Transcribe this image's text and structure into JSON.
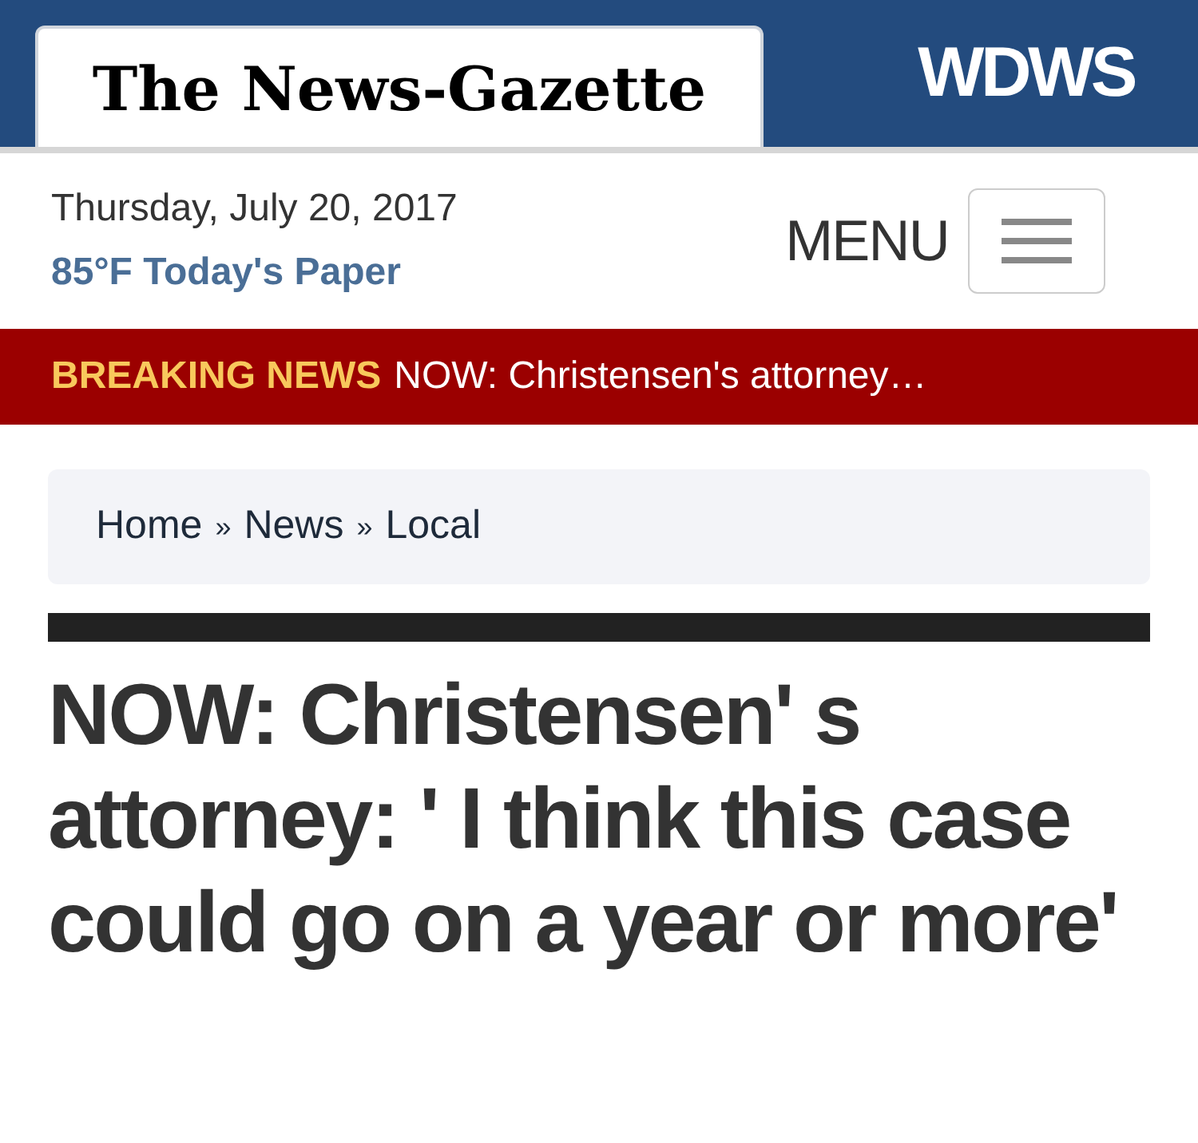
{
  "header": {
    "logo": "The News-Gazette",
    "station_link": "WDWS"
  },
  "date": "Thursday, July 20, 2017",
  "weather_link": "85°F Today's Paper",
  "menu": {
    "label": "MENU"
  },
  "breaking": {
    "label": "BREAKING NEWS",
    "headline": "NOW: Christensen's attorney…"
  },
  "breadcrumb": [
    {
      "label": "Home",
      "separator": "»"
    },
    {
      "label": "News",
      "separator": "»"
    },
    {
      "label": "Local"
    }
  ],
  "article": {
    "title": "NOW: Christensen' s attorney: ' I think this case could go on a year or more'"
  }
}
